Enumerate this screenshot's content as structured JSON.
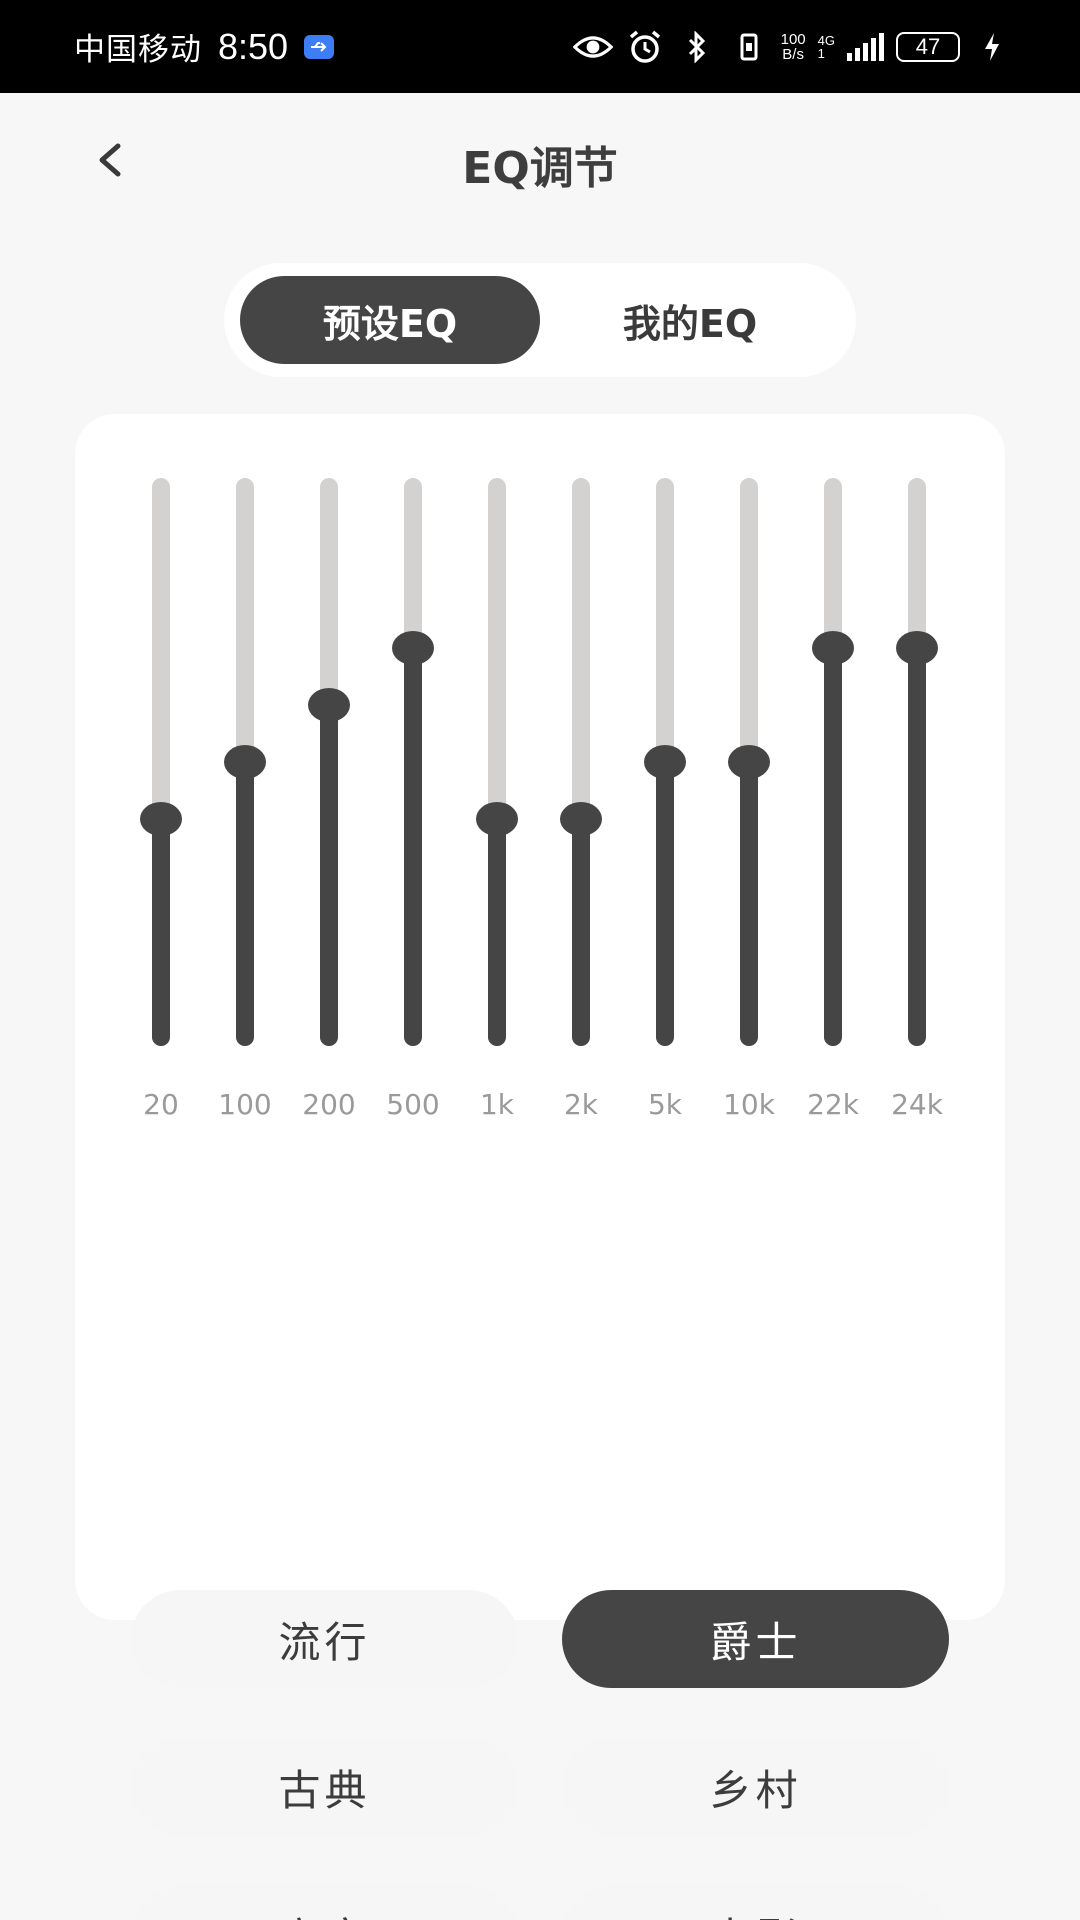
{
  "status_bar": {
    "carrier": "中国移动",
    "time": "8:50",
    "net_speed_top": "100",
    "net_speed_bottom": "B/s",
    "network_type": "4G",
    "sim_slot": "1",
    "battery": "47"
  },
  "header": {
    "back_label": "<",
    "title": "EQ调节"
  },
  "tabs": [
    {
      "label": "预设EQ",
      "active": true
    },
    {
      "label": "我的EQ",
      "active": false
    }
  ],
  "eq": {
    "bands": [
      {
        "label": "20",
        "level": 0.4
      },
      {
        "label": "100",
        "level": 0.5
      },
      {
        "label": "200",
        "level": 0.6
      },
      {
        "label": "500",
        "level": 0.7
      },
      {
        "label": "1k",
        "level": 0.4
      },
      {
        "label": "2k",
        "level": 0.4
      },
      {
        "label": "5k",
        "level": 0.5
      },
      {
        "label": "10k",
        "level": 0.5
      },
      {
        "label": "22k",
        "level": 0.7
      },
      {
        "label": "24k",
        "level": 0.7
      }
    ]
  },
  "presets": [
    {
      "label": "流行",
      "selected": false
    },
    {
      "label": "爵士",
      "selected": true
    },
    {
      "label": "古典",
      "selected": false
    },
    {
      "label": "乡村",
      "selected": false
    },
    {
      "label": "高音",
      "selected": false
    },
    {
      "label": "电影",
      "selected": false
    }
  ],
  "colors": {
    "accent_dark": "#454545",
    "track": "#d4d2d1",
    "background": "#f7f7f7",
    "card": "#ffffff"
  }
}
